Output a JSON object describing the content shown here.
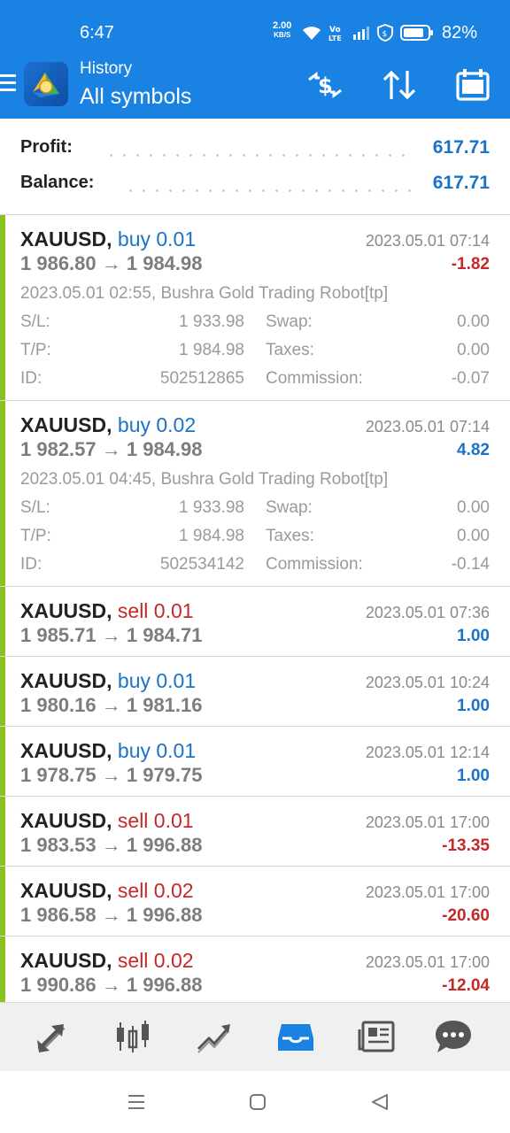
{
  "status_bar": {
    "time": "6:47",
    "net_speed_value": "2.00",
    "net_speed_unit": "KB/S",
    "battery": "82%"
  },
  "header": {
    "subtitle": "History",
    "title": "All symbols",
    "icons": [
      "menu-icon",
      "currency-exchange-icon",
      "sort-icon",
      "calendar-icon"
    ]
  },
  "summary": {
    "profit_label": "Profit:",
    "profit_value": "617.71",
    "balance_label": "Balance:",
    "balance_value": "617.71"
  },
  "trades": [
    {
      "symbol": "XAUUSD,",
      "direction": "buy 0.01",
      "prices": "1 986.80 → 1 984.98",
      "time": "2023.05.01 07:14",
      "profit": "-1.82",
      "expanded": true,
      "comment": "2023.05.01 02:55, Bushra Gold Trading Robot[tp]",
      "sl_label": "S/L:",
      "sl": "1 933.98",
      "tp_label": "T/P:",
      "tp": "1 984.98",
      "id_label": "ID:",
      "id": "502512865",
      "swap_label": "Swap:",
      "swap": "0.00",
      "taxes_label": "Taxes:",
      "taxes": "0.00",
      "commission_label": "Commission:",
      "commission": "-0.07"
    },
    {
      "symbol": "XAUUSD,",
      "direction": "buy 0.02",
      "prices": "1 982.57 → 1 984.98",
      "time": "2023.05.01 07:14",
      "profit": "4.82",
      "expanded": true,
      "comment": "2023.05.01 04:45, Bushra Gold Trading Robot[tp]",
      "sl_label": "S/L:",
      "sl": "1 933.98",
      "tp_label": "T/P:",
      "tp": "1 984.98",
      "id_label": "ID:",
      "id": "502534142",
      "swap_label": "Swap:",
      "swap": "0.00",
      "taxes_label": "Taxes:",
      "taxes": "0.00",
      "commission_label": "Commission:",
      "commission": "-0.14"
    },
    {
      "symbol": "XAUUSD,",
      "direction": "sell 0.01",
      "prices": "1 985.71 → 1 984.71",
      "time": "2023.05.01 07:36",
      "profit": "1.00",
      "expanded": false
    },
    {
      "symbol": "XAUUSD,",
      "direction": "buy 0.01",
      "prices": "1 980.16 → 1 981.16",
      "time": "2023.05.01 10:24",
      "profit": "1.00",
      "expanded": false
    },
    {
      "symbol": "XAUUSD,",
      "direction": "buy 0.01",
      "prices": "1 978.75 → 1 979.75",
      "time": "2023.05.01 12:14",
      "profit": "1.00",
      "expanded": false
    },
    {
      "symbol": "XAUUSD,",
      "direction": "sell 0.01",
      "prices": "1 983.53 → 1 996.88",
      "time": "2023.05.01 17:00",
      "profit": "-13.35",
      "expanded": false
    },
    {
      "symbol": "XAUUSD,",
      "direction": "sell 0.02",
      "prices": "1 986.58 → 1 996.88",
      "time": "2023.05.01 17:00",
      "profit": "-20.60",
      "expanded": false
    },
    {
      "symbol": "XAUUSD,",
      "direction": "sell 0.02",
      "prices": "1 990.86 → 1 996.88",
      "time": "2023.05.01 17:00",
      "profit": "-12.04",
      "expanded": false
    }
  ],
  "bottom_nav": {
    "items": [
      "quotes-icon",
      "chart-icon",
      "trade-icon",
      "history-icon",
      "news-icon",
      "chat-icon"
    ],
    "active": "history-icon"
  },
  "colors": {
    "header": "#1a82e2",
    "buy": "#1a73c8",
    "sell": "#c62828",
    "accent": "#8ac320",
    "active_nav": "#1a82e2"
  }
}
